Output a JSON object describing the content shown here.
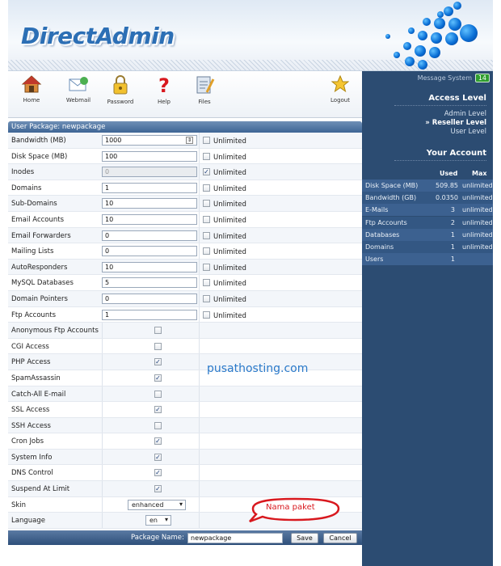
{
  "header": {
    "logo": "DirectAdmin"
  },
  "toolbar": {
    "home": "Home",
    "webmail": "Webmail",
    "password": "Password",
    "help": "Help",
    "files": "Files",
    "logout": "Logout"
  },
  "sidebar": {
    "message_system": "Message System",
    "message_count": "14",
    "access_level_title": "Access Level",
    "levels": {
      "admin": "Admin Level",
      "reseller": "» Reseller Level",
      "user": "User Level"
    },
    "account_title": "Your Account",
    "col_used": "Used",
    "col_max": "Max",
    "usage": [
      {
        "label": "Disk Space (MB)",
        "used": "509.85",
        "max": "unlimited"
      },
      {
        "label": "Bandwidth (GB)",
        "used": "0.0350",
        "max": "unlimited"
      },
      {
        "label": "E-Mails",
        "used": "3",
        "max": "unlimited"
      },
      {
        "label": "Ftp Accounts",
        "used": "2",
        "max": "unlimited"
      },
      {
        "label": "Databases",
        "used": "1",
        "max": "unlimited"
      },
      {
        "label": "Domains",
        "used": "1",
        "max": "unlimited"
      },
      {
        "label": "Users",
        "used": "1",
        "max": ""
      }
    ]
  },
  "package": {
    "header": "User Package: newpackage",
    "unlimited_label": "Unlimited",
    "fields": [
      {
        "label": "Bandwidth (MB)",
        "value": "1000",
        "unlimited": false
      },
      {
        "label": "Disk Space (MB)",
        "value": "100",
        "unlimited": false
      },
      {
        "label": "Inodes",
        "value": "0",
        "unlimited": true
      },
      {
        "label": "Domains",
        "value": "1",
        "unlimited": false
      },
      {
        "label": "Sub-Domains",
        "value": "10",
        "unlimited": false
      },
      {
        "label": "Email Accounts",
        "value": "10",
        "unlimited": false
      },
      {
        "label": "Email Forwarders",
        "value": "0",
        "unlimited": false
      },
      {
        "label": "Mailing Lists",
        "value": "0",
        "unlimited": false
      },
      {
        "label": "AutoResponders",
        "value": "10",
        "unlimited": false
      },
      {
        "label": "MySQL Databases",
        "value": "5",
        "unlimited": false
      },
      {
        "label": "Domain Pointers",
        "value": "0",
        "unlimited": false
      },
      {
        "label": "Ftp Accounts",
        "value": "1",
        "unlimited": false
      }
    ],
    "options": [
      {
        "label": "Anonymous Ftp Accounts",
        "checked": false
      },
      {
        "label": "CGI Access",
        "checked": false
      },
      {
        "label": "PHP Access",
        "checked": true
      },
      {
        "label": "SpamAssassin",
        "checked": true
      },
      {
        "label": "Catch-All E-mail",
        "checked": false
      },
      {
        "label": "SSL Access",
        "checked": true
      },
      {
        "label": "SSH Access",
        "checked": false
      },
      {
        "label": "Cron Jobs",
        "checked": true
      },
      {
        "label": "System Info",
        "checked": true
      },
      {
        "label": "DNS Control",
        "checked": true
      },
      {
        "label": "Suspend At Limit",
        "checked": true
      }
    ],
    "skin_label": "Skin",
    "skin_value": "enhanced",
    "language_label": "Language",
    "language_value": "en",
    "package_name_label": "Package Name:",
    "package_name_value": "newpackage",
    "save_label": "Save",
    "cancel_label": "Cancel"
  },
  "annotations": {
    "watermark": "pusathosting.com",
    "bubble": "Nama paket"
  },
  "colors": {
    "sidebar": "#2c4c72",
    "accent": "#2c6fb5",
    "badge": "#2f9e2f",
    "bubble": "#d8181e"
  }
}
